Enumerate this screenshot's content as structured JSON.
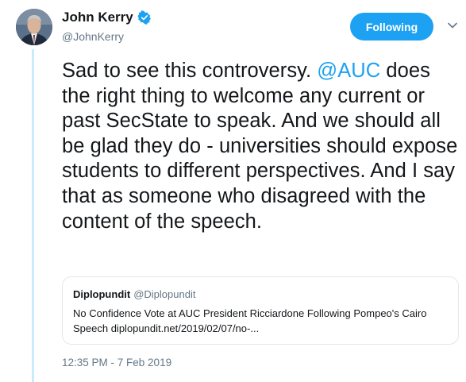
{
  "author": {
    "name": "John Kerry",
    "handle": "@JohnKerry",
    "verified": true,
    "avatar": "avatar-photo"
  },
  "follow_button": {
    "label": "Following"
  },
  "menu_icon": "chevron-down-icon",
  "tweet": {
    "text_before_mention": "Sad to see this controversy. ",
    "mention": "@AUC",
    "text_after_mention": " does the right thing to welcome any current or past SecState to speak. And we should all be glad they do - universities should expose students to different perspectives. And I say that as someone who disagreed with the content of the speech."
  },
  "quoted_tweet": {
    "name": "Diplopundit",
    "handle": "@Diplopundit",
    "text": "No Confidence Vote at AUC President Ricciardone Following Pompeo's Cairo Speech diplopundit.net/2019/02/07/no-..."
  },
  "timestamp": "12:35 PM - 7 Feb 2019",
  "colors": {
    "accent": "#1da1f2",
    "text": "#14171a",
    "muted": "#657786",
    "thread_line": "#c8ebfd",
    "card_border": "#e1e8ed"
  }
}
